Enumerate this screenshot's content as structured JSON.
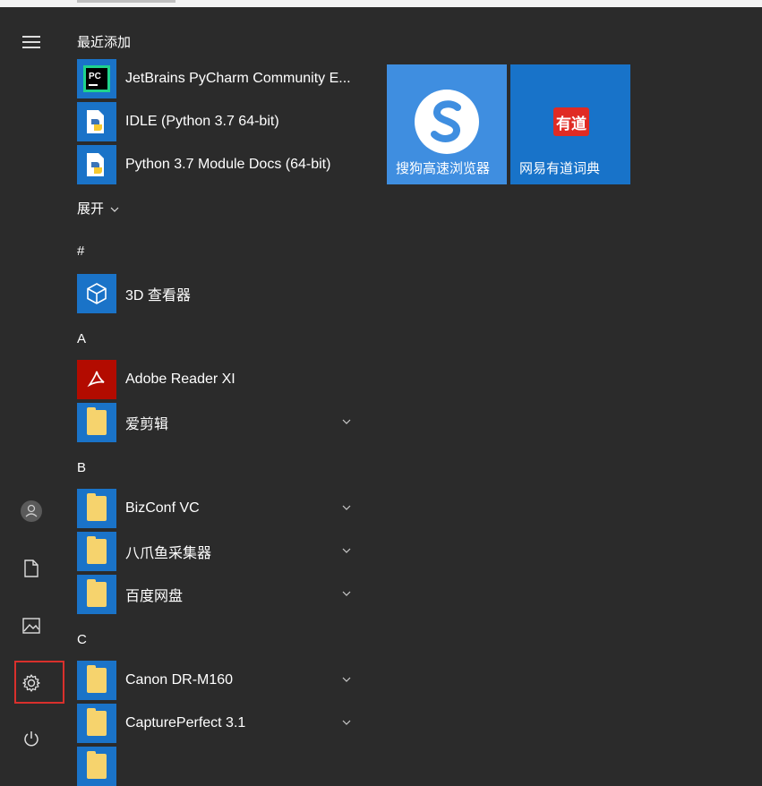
{
  "recent_header": "最近添加",
  "expand_label": "展开",
  "recent": [
    {
      "label": "JetBrains PyCharm Community E...",
      "icon": "pycharm-icon"
    },
    {
      "label": "IDLE (Python 3.7 64-bit)",
      "icon": "python-icon"
    },
    {
      "label": "Python 3.7 Module Docs (64-bit)",
      "icon": "python-docs-icon"
    }
  ],
  "sections": [
    {
      "letter": "#",
      "items": [
        {
          "label": "3D 查看器",
          "icon": "cube-icon",
          "expandable": false
        }
      ]
    },
    {
      "letter": "A",
      "items": [
        {
          "label": "Adobe Reader XI",
          "icon": "pdf-icon",
          "expandable": false
        },
        {
          "label": "爱剪辑",
          "icon": "folder-icon",
          "expandable": true
        }
      ]
    },
    {
      "letter": "B",
      "items": [
        {
          "label": "BizConf VC",
          "icon": "folder-icon",
          "expandable": true
        },
        {
          "label": "八爪鱼采集器",
          "icon": "folder-icon",
          "expandable": true
        },
        {
          "label": "百度网盘",
          "icon": "folder-icon",
          "expandable": true
        }
      ]
    },
    {
      "letter": "C",
      "items": [
        {
          "label": "Canon DR-M160",
          "icon": "folder-icon",
          "expandable": true
        },
        {
          "label": "CapturePerfect 3.1",
          "icon": "folder-icon",
          "expandable": true
        }
      ]
    }
  ],
  "tiles": [
    {
      "name": "搜狗高速浏览器",
      "color": "#3f8ee0",
      "icon": "sogou-browser-icon"
    },
    {
      "name": "网易有道词典",
      "color": "#1873c9",
      "icon": "youdao-icon",
      "badge": "有道"
    }
  ],
  "colors": {
    "background": "#2b2b2b",
    "tile_blue": "#1a73c8",
    "highlight": "#d9302c",
    "folder": "#f6d36d"
  }
}
